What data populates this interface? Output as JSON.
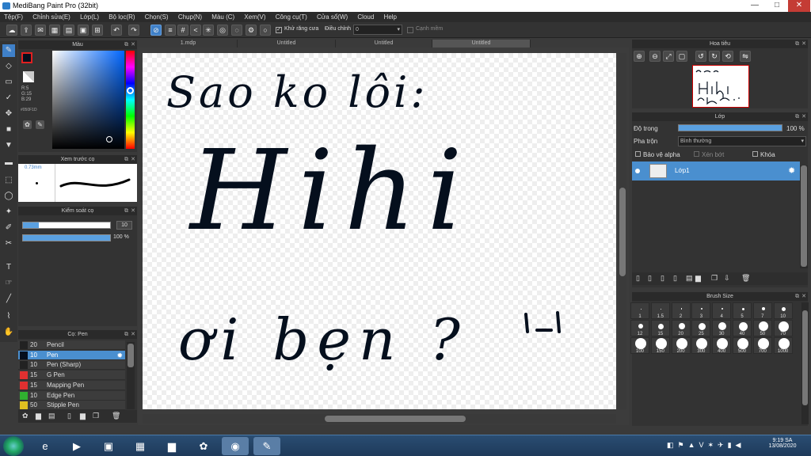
{
  "window": {
    "title": "MediBang Paint Pro (32bit)",
    "min": "—",
    "max": "□",
    "close": "✕"
  },
  "menu": [
    "Tệp(F)",
    "Chỉnh sửa(E)",
    "Lớp(L)",
    "Bộ lọc(R)",
    "Chọn(S)",
    "Chụp(N)",
    "Màu (C)",
    "Xem(V)",
    "Công cụ(T)",
    "Cửa sổ(W)",
    "Cloud",
    "Help"
  ],
  "toolbar": {
    "antialias_label": "Khử răng cưa",
    "correction_label": "Điều chỉnh",
    "correction_value": "0",
    "dropdown_arrow": "▾",
    "snap_label": "Cạnh mềm"
  },
  "tabs": [
    "1.mdp",
    "Untitled",
    "Untitled",
    "Untitled"
  ],
  "color_panel": {
    "title": "Màu",
    "r": "R:5",
    "g": "G:15",
    "b": "B:29",
    "hex": "#050F1D",
    "main_color": "#050F1D"
  },
  "brush_preview": {
    "title": "Xem trước cọ",
    "size": "0.73mm"
  },
  "brush_control": {
    "title": "Kiểm soát cọ",
    "size_value": "10",
    "opacity_value": "100 %"
  },
  "brush_list": {
    "title": "Cọ: Pen",
    "items": [
      {
        "size": "20",
        "name": "Pencil",
        "color": "#222222"
      },
      {
        "size": "10",
        "name": "Pen",
        "color": "#050F1D"
      },
      {
        "size": "10",
        "name": "Pen (Sharp)",
        "color": "#222222"
      },
      {
        "size": "15",
        "name": "G Pen",
        "color": "#e03030"
      },
      {
        "size": "15",
        "name": "Mapping Pen",
        "color": "#e03030"
      },
      {
        "size": "10",
        "name": "Edge Pen",
        "color": "#30b030"
      },
      {
        "size": "50",
        "name": "Stipple Pen",
        "color": "#e0c020"
      }
    ]
  },
  "navigator": {
    "title": "Hoa tiêu"
  },
  "layer_panel": {
    "title": "Lớp",
    "opacity_label": "Độ trong",
    "opacity_value": "100 %",
    "blend_label": "Pha trộn",
    "blend_value": "Bình thường",
    "protect_alpha": "Bảo vệ alpha",
    "clipping": "Xén bớt",
    "lock": "Khóa",
    "layer_name": "Lớp1"
  },
  "brush_size": {
    "title": "Brush Size",
    "sizes": [
      "1",
      "1.5",
      "2",
      "3",
      "4",
      "5",
      "7",
      "10",
      "12",
      "15",
      "20",
      "25",
      "30",
      "40",
      "50",
      "70",
      "100",
      "150",
      "200",
      "300",
      "400",
      "500",
      "700",
      "1000"
    ]
  },
  "canvas_text": [
    "Sao ko lôi:",
    "Hihi",
    "ơi bẹn ?"
  ],
  "tray": {
    "time": "9:19 SA",
    "date": "13/08/2020"
  }
}
